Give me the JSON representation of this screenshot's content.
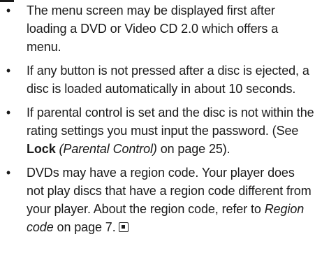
{
  "notes": [
    {
      "bullet": "•",
      "segments": [
        {
          "text": "The menu screen may be displayed first after loading a DVD or Video CD 2.0 which offers a menu.",
          "style": "normal"
        }
      ]
    },
    {
      "bullet": "•",
      "segments": [
        {
          "text": "If any button is not pressed after a disc is ejected, a disc is loaded automatically in about 10 seconds.",
          "style": "normal"
        }
      ]
    },
    {
      "bullet": "•",
      "segments": [
        {
          "text": "If parental control is set and the disc is not within the rating settings you must input the password. (See ",
          "style": "normal"
        },
        {
          "text": "Lock",
          "style": "bold"
        },
        {
          "text": " ",
          "style": "normal"
        },
        {
          "text": "(Parental Control)",
          "style": "italic"
        },
        {
          "text": " on page 25).",
          "style": "normal"
        }
      ]
    },
    {
      "bullet": "•",
      "segments": [
        {
          "text": "DVDs may have a region code. Your player does not play discs that have a region code different from your player. About the region code, refer to ",
          "style": "normal"
        },
        {
          "text": "Region code",
          "style": "italic"
        },
        {
          "text": " on page 7.",
          "style": "normal"
        }
      ],
      "end_icon": "end-of-section-icon"
    }
  ]
}
